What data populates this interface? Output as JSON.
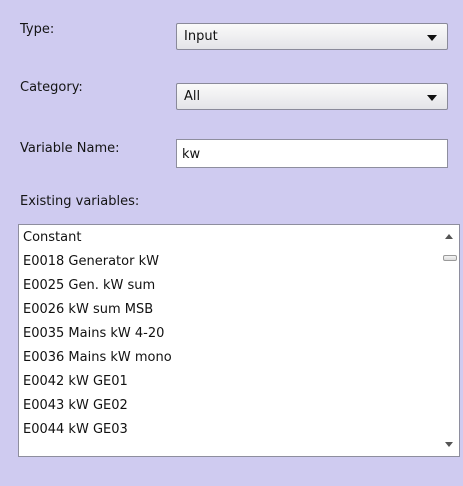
{
  "form": {
    "type": {
      "label": "Type:",
      "value": "Input"
    },
    "category": {
      "label": "Category:",
      "value": "All"
    },
    "variable_name": {
      "label": "Variable Name:",
      "value": "kw"
    },
    "existing_label": "Existing variables:"
  },
  "existing_variables": [
    "Constant",
    "E0018 Generator kW",
    "E0025 Gen. kW sum",
    "E0026 kW sum MSB",
    "E0035 Mains kW 4-20",
    "E0036 Mains kW mono",
    "E0042 kW GE01",
    "E0043 kW GE02",
    "E0044 kW GE03"
  ],
  "icons": {
    "dropdown": "chevron-down-icon",
    "scroll_up": "scroll-up-arrow-icon",
    "scroll_down": "scroll-down-arrow-icon"
  },
  "colors": {
    "panel_background": "#cfcbf0",
    "field_border": "#8e8e9e"
  }
}
